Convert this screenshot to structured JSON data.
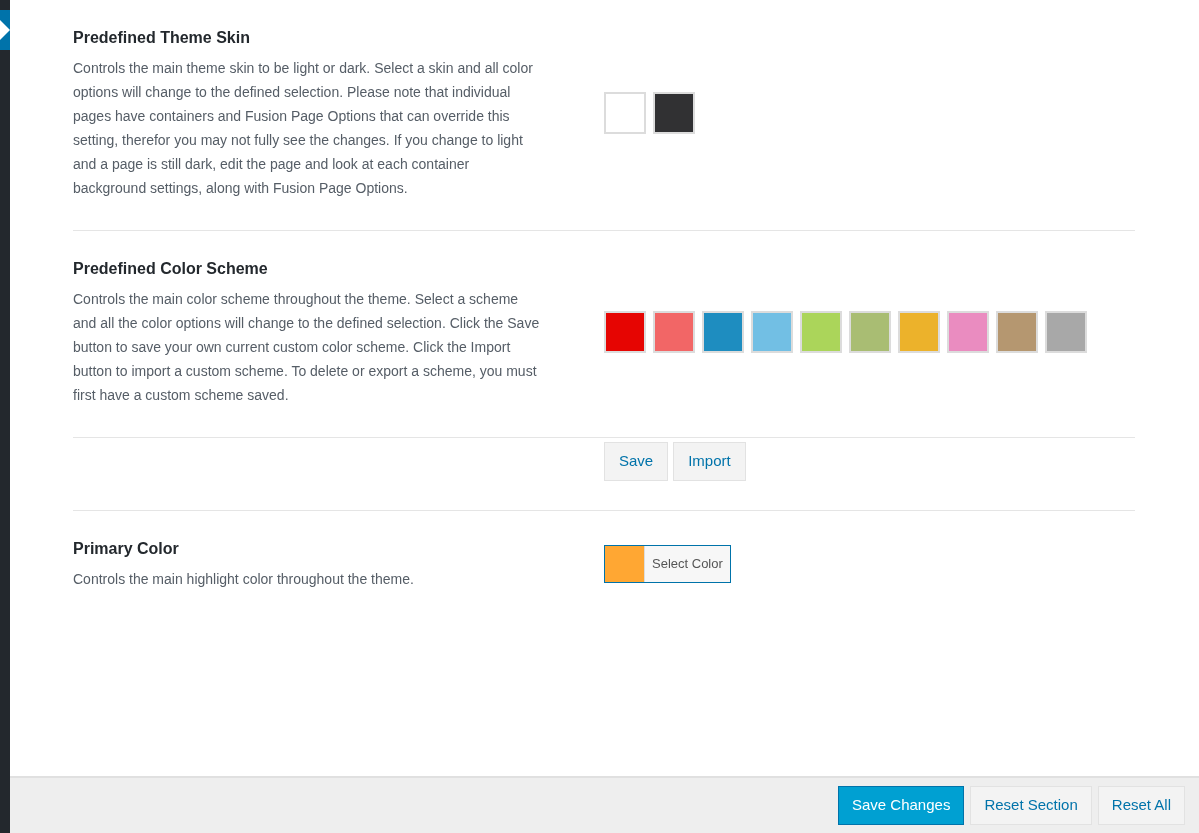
{
  "sections": [
    {
      "title": "Predefined Theme Skin",
      "description": "Controls the main theme skin to be light or dark. Select a skin and all color options will change to the defined selection. Please note that individual pages have containers and Fusion Page Options that can override this setting, therefor you may not fully see the changes. If you change to light and a page is still dark, edit the page and look at each container background settings, along with Fusion Page Options.",
      "kind": "swatches",
      "swatches": [
        {
          "color": "#ffffff"
        },
        {
          "color": "#313133"
        }
      ]
    },
    {
      "title": "Predefined Color Scheme",
      "description": "Controls the main color scheme throughout the theme. Select a scheme and all the color options will change to the defined selection. Click the Save button to save your own current custom color scheme. Click the Import button to import a custom scheme. To delete or export a scheme, you must first have a custom scheme saved.",
      "kind": "swatches",
      "swatches": [
        {
          "color": "#e60502"
        },
        {
          "color": "#f26666"
        },
        {
          "color": "#1e8dc0"
        },
        {
          "color": "#72bfe4"
        },
        {
          "color": "#abd55a"
        },
        {
          "color": "#a9bd73"
        },
        {
          "color": "#ecb22b"
        },
        {
          "color": "#ea8cc0"
        },
        {
          "color": "#b59770"
        },
        {
          "color": "#a8a8a8"
        }
      ],
      "buttons": [
        "Save",
        "Import"
      ]
    },
    {
      "title": "Primary Color",
      "description": "Controls the main highlight color throughout the theme.",
      "kind": "color_picker",
      "color": "#ffa733",
      "button": "Select Color"
    }
  ],
  "footer": {
    "buttons": [
      {
        "label": "Save Changes",
        "kind": "primary"
      },
      {
        "label": "Reset Section",
        "kind": "secondary"
      },
      {
        "label": "Reset All",
        "kind": "secondary"
      }
    ]
  }
}
